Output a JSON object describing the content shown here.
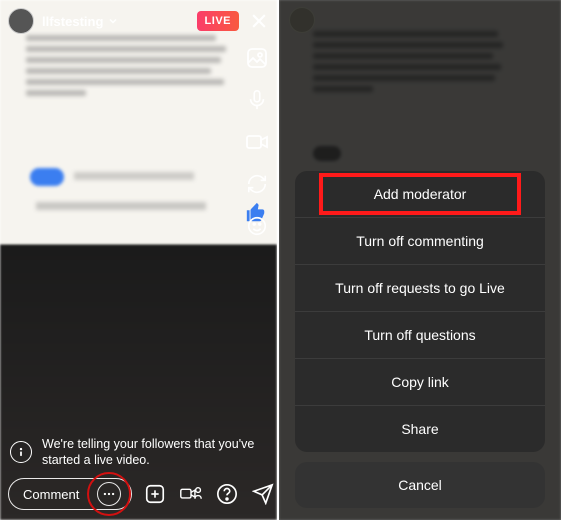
{
  "left": {
    "username": "llfstesting",
    "live_badge": "LIVE",
    "toast": "We're telling your followers that you've started a live video.",
    "comment_placeholder": "Comment"
  },
  "right": {
    "sheet": {
      "items": [
        "Add moderator",
        "Turn off commenting",
        "Turn off requests to go Live",
        "Turn off questions",
        "Copy link",
        "Share"
      ],
      "cancel": "Cancel"
    }
  }
}
